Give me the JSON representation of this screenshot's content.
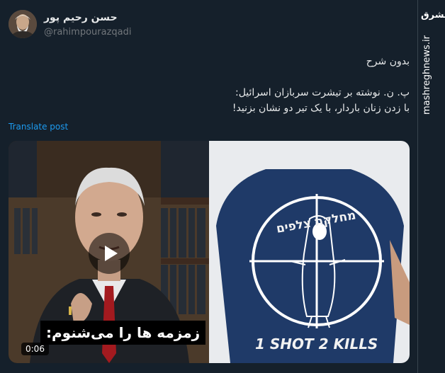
{
  "author": {
    "display_name": "حسن رحیم پور",
    "handle": "@rahimpourazqadi"
  },
  "tweet": {
    "lines": [
      "بدون شرح",
      "",
      "پ. ن. نوشته بر تیشرت سربازان اسرائیل:",
      "با زدن زنان باردار، با یک تیر دو نشان بزنید!"
    ],
    "translate_label": "Translate post"
  },
  "media": {
    "video": {
      "subtitle": "زمزمه ها را می‌شنوم:",
      "duration": "0:06",
      "play_icon": "play-icon"
    },
    "photo": {
      "shirt_hebrew": "מחלקת צלפים",
      "shirt_caption": "1 SHOT 2 KILLS"
    }
  },
  "watermark": {
    "logo_text": "مشرق",
    "url": "mashreghnews.ir"
  },
  "colors": {
    "background": "#15202b",
    "link": "#1d9bf0",
    "shirt": "#1f3a68"
  }
}
